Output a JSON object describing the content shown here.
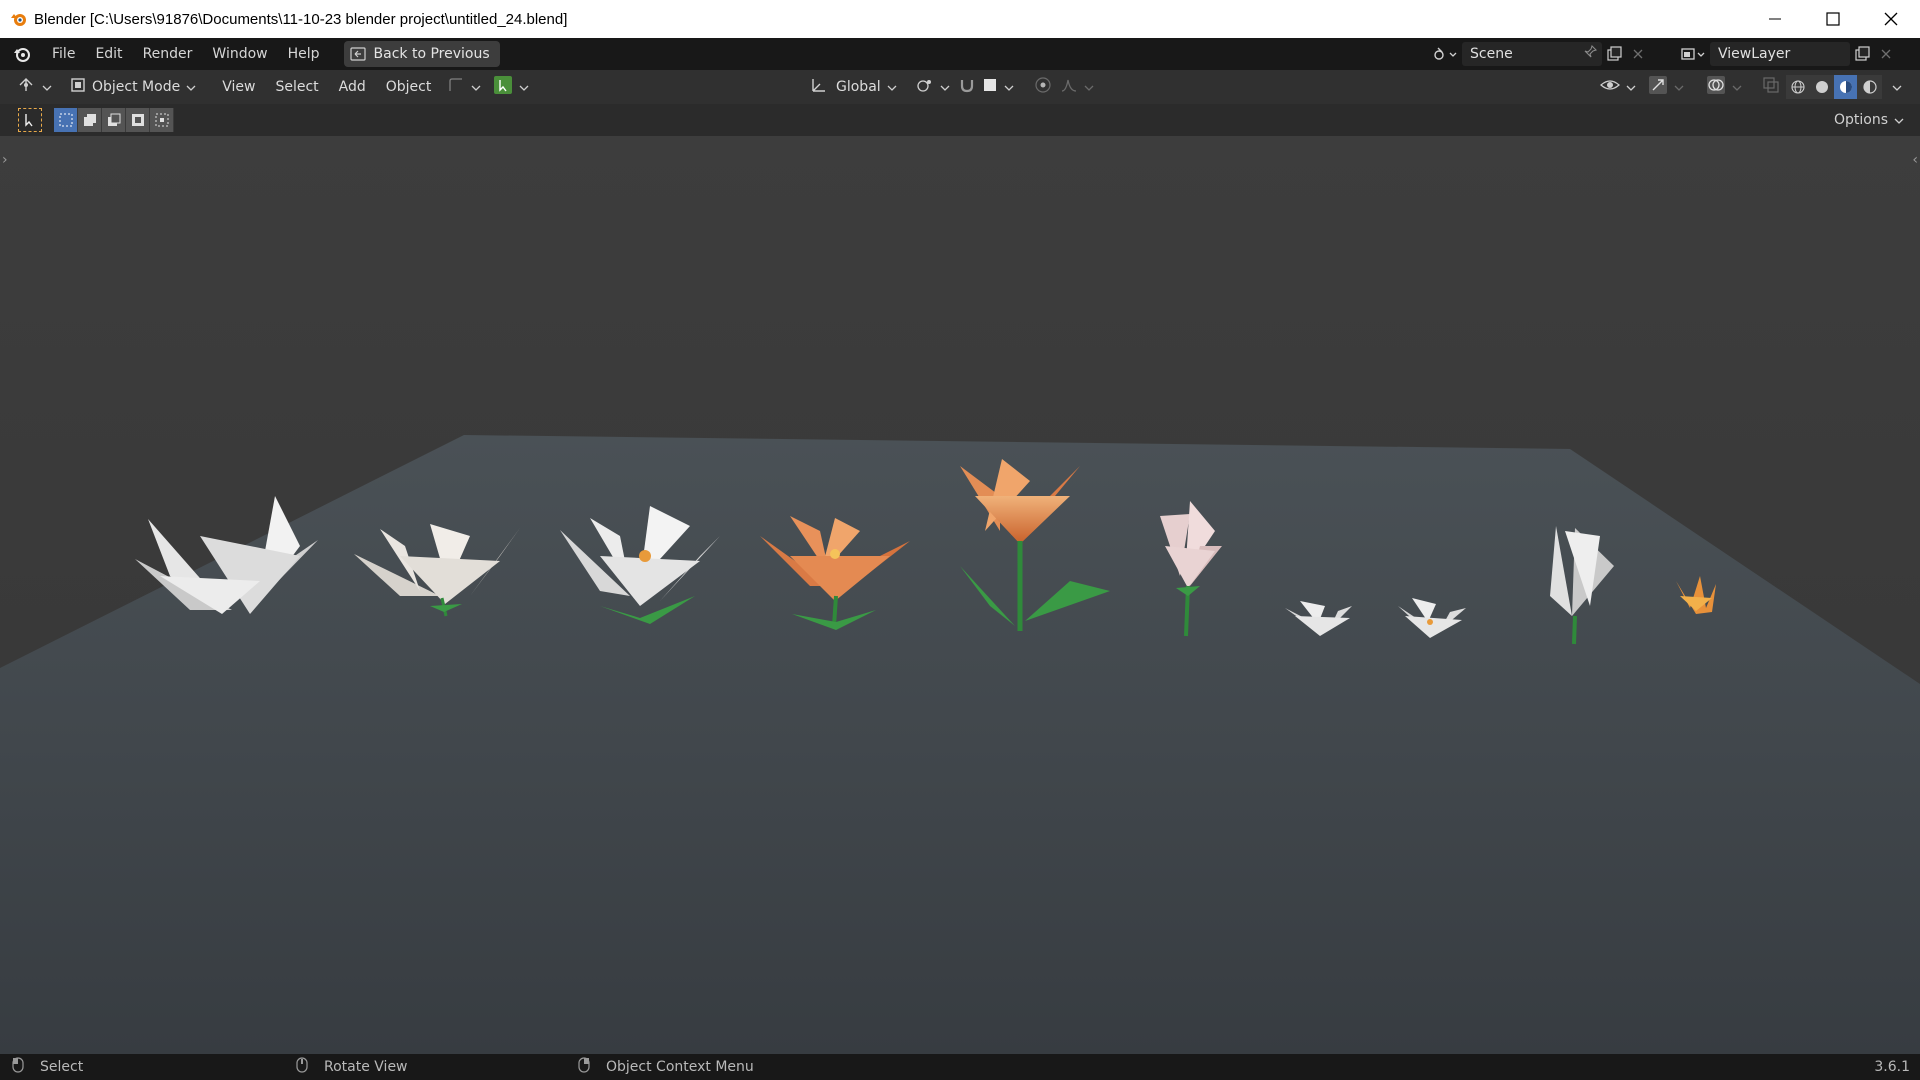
{
  "window": {
    "title": "Blender [C:\\Users\\91876\\Documents\\11-10-23 blender project\\untitled_24.blend]",
    "controls": [
      "minimize-icon",
      "maximize-icon",
      "close-icon"
    ]
  },
  "menubar": {
    "items": [
      "File",
      "Edit",
      "Render",
      "Window",
      "Help"
    ],
    "back_label": "Back to Previous",
    "scene_label": "Scene",
    "viewlayer_label": "ViewLayer"
  },
  "header": {
    "mode_label": "Object Mode",
    "menus": [
      "View",
      "Select",
      "Add",
      "Object"
    ],
    "transform_orientation": "Global",
    "options_label": "Options"
  },
  "statusbar": {
    "select_label": "Select",
    "rotate_label": "Rotate View",
    "context_label": "Object Context Menu",
    "version": "3.6.1"
  },
  "colors": {
    "accent": "#4772b3",
    "floor": "#3e4347",
    "background": "#3a3a3a",
    "petal_white": "#e8e8e8",
    "petal_orange": "#e0894f",
    "stem_green": "#2f8a3a"
  }
}
